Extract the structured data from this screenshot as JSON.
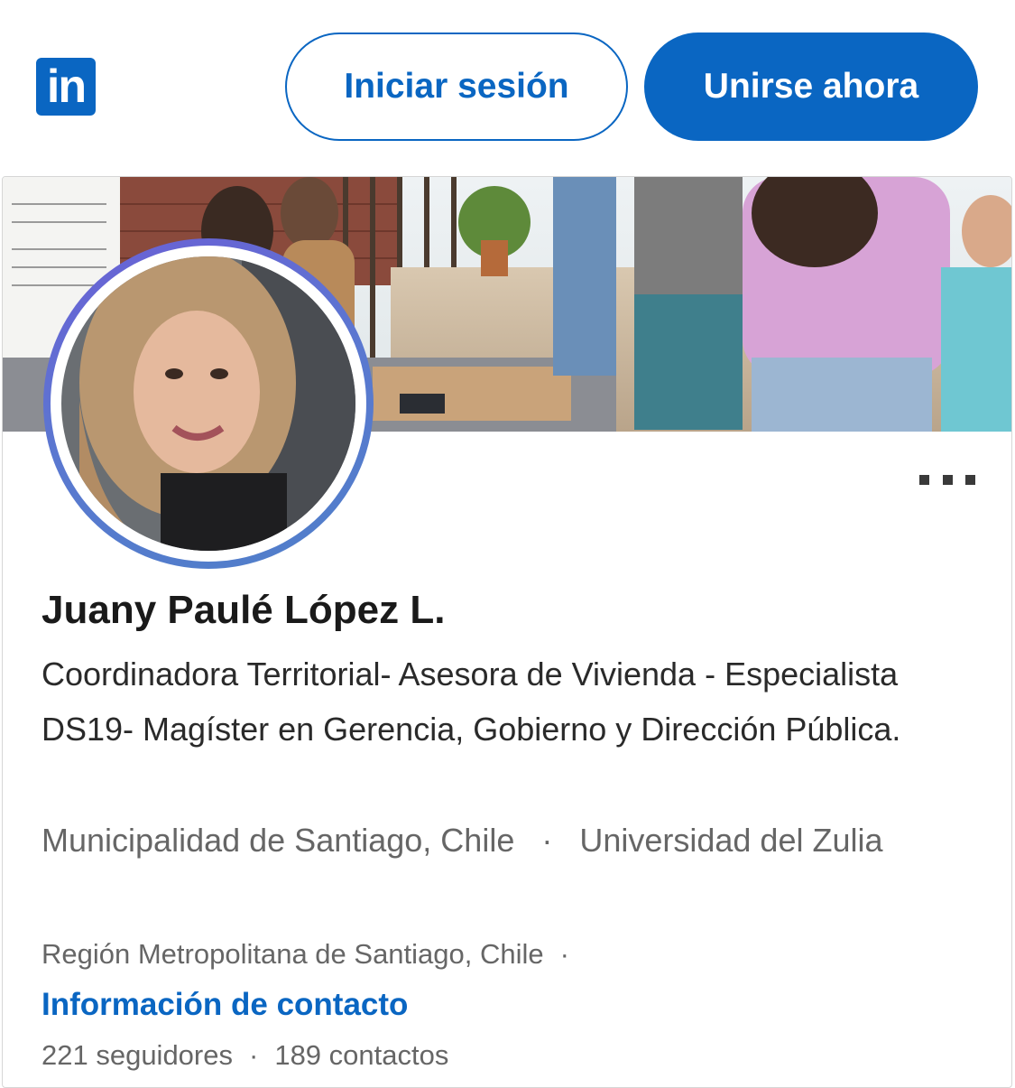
{
  "header": {
    "logo_text": "in",
    "signin_label": "Iniciar sesión",
    "join_label": "Unirse ahora",
    "accent_color": "#0a66c2"
  },
  "profile": {
    "name": "Juany Paulé López L.",
    "headline": "Coordinadora Territorial- Asesora de Vivienda - Especialista DS19- Magíster en Gerencia, Gobierno y Dirección Pública.",
    "organization": "Municipalidad de Santiago, Chile",
    "education": "Universidad del Zulia",
    "separator": "·",
    "location": "Región Metropolitana de Santiago, Chile",
    "contact_link": "Información de contacto",
    "followers": "221 seguidores",
    "connections": "189 contactos"
  },
  "icons": {
    "logo": "linkedin-logo-icon",
    "more": "more-options-icon"
  }
}
